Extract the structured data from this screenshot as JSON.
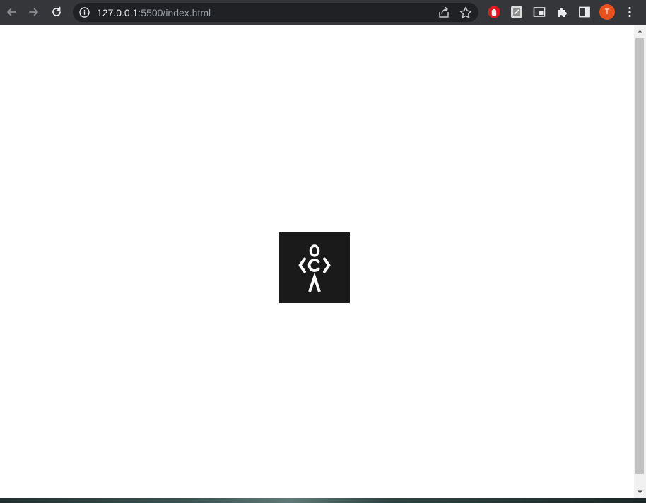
{
  "browser": {
    "url_host": "127.0.0.1",
    "url_rest": ":5500/index.html",
    "profile_initial": "T"
  },
  "colors": {
    "toolbar": "#35363a",
    "omnibox": "#202124",
    "logo_background": "#1a1a1a",
    "avatar": "#e8501e",
    "page_background": "#ffffff"
  },
  "icons": {
    "back": "back-arrow-icon",
    "forward": "forward-arrow-icon",
    "reload": "reload-icon",
    "site_info": "info-icon",
    "share": "share-icon",
    "bookmark": "star-icon",
    "extension_1": "adblock-hand-icon",
    "extension_2": "screenshot-extension-icon",
    "extension_3": "picture-in-picture-icon",
    "extensions": "puzzle-icon",
    "side_panel": "side-panel-icon",
    "menu": "kebab-menu-icon"
  },
  "page": {
    "logo_name": "figure-with-code-brackets-logo"
  }
}
